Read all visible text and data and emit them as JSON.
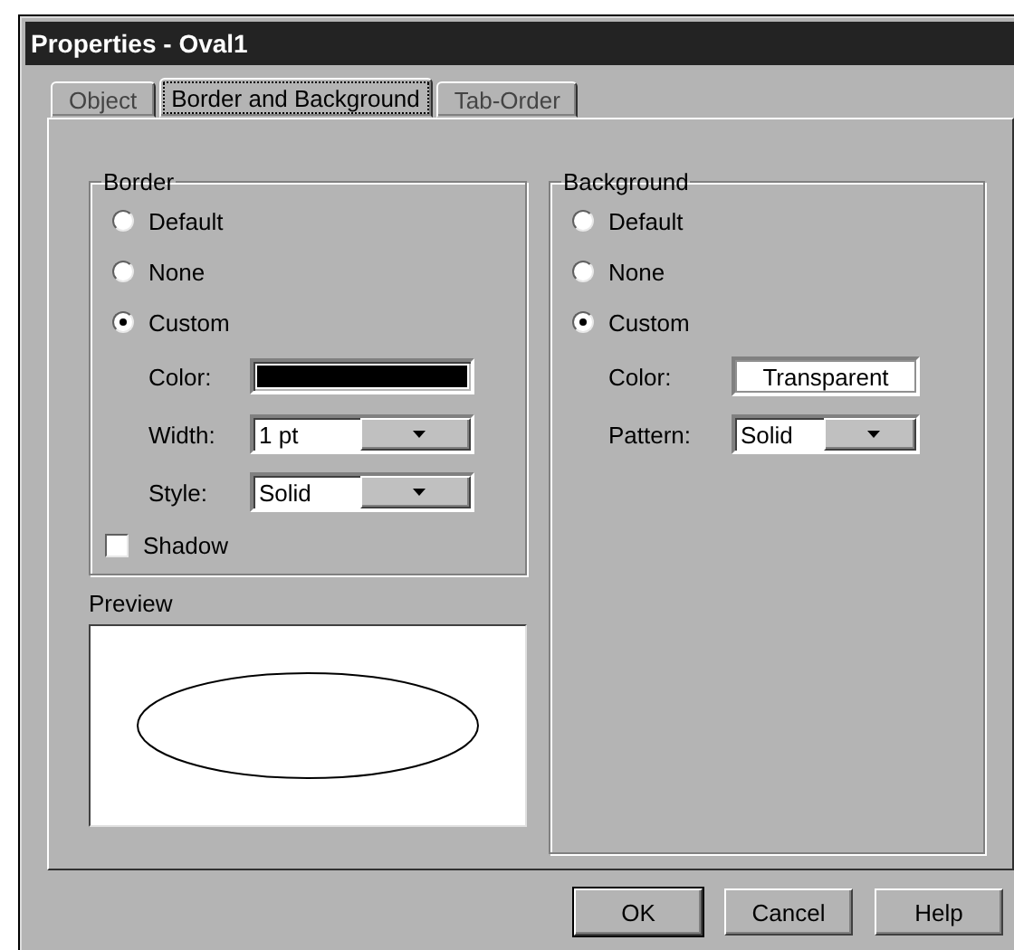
{
  "window": {
    "title": "Properties - Oval1"
  },
  "tabs": [
    {
      "label": "Object",
      "selected": false
    },
    {
      "label": "Border and Background",
      "selected": true
    },
    {
      "label": "Tab-Order",
      "selected": false
    }
  ],
  "border": {
    "title": "Border",
    "options": [
      {
        "label": "Default",
        "selected": false
      },
      {
        "label": "None",
        "selected": false
      },
      {
        "label": "Custom",
        "selected": true
      }
    ],
    "fields": [
      {
        "kind": "swatch",
        "label": "Color:",
        "color": "#000000"
      },
      {
        "kind": "combo",
        "label": "Width:",
        "value": "1 pt"
      },
      {
        "kind": "combo",
        "label": "Style:",
        "value": "Solid"
      }
    ],
    "shadow": {
      "label": "Shadow",
      "checked": false
    }
  },
  "preview": {
    "label": "Preview"
  },
  "background": {
    "title": "Background",
    "options": [
      {
        "label": "Default",
        "selected": false
      },
      {
        "label": "None",
        "selected": false
      },
      {
        "label": "Custom",
        "selected": true
      }
    ],
    "fields": [
      {
        "kind": "text",
        "label": "Color:",
        "value": "Transparent"
      },
      {
        "kind": "combo",
        "label": "Pattern:",
        "value": "Solid"
      }
    ]
  },
  "buttons": [
    "OK",
    "Cancel",
    "Help"
  ]
}
